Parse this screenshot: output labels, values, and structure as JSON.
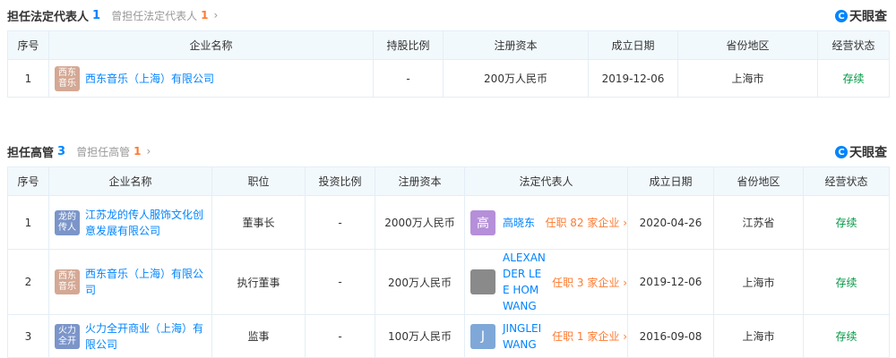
{
  "brand": {
    "name": "天眼查",
    "mark": "C"
  },
  "section1": {
    "title": "担任法定代表人",
    "count": "1",
    "sub_label": "曾担任法定代表人",
    "sub_count": "1",
    "headers": [
      "序号",
      "企业名称",
      "持股比例",
      "注册资本",
      "成立日期",
      "省份地区",
      "经营状态"
    ],
    "rows": [
      {
        "idx": "1",
        "logo_text": "西东\n音乐",
        "logo_color": "#d4a894",
        "company": "西东音乐（上海）有限公司",
        "share": "-",
        "capital": "200万人民币",
        "date": "2019-12-06",
        "region": "上海市",
        "status": "存续"
      }
    ]
  },
  "section2": {
    "title": "担任高管",
    "count": "3",
    "sub_label": "曾担任高管",
    "sub_count": "1",
    "headers": [
      "序号",
      "企业名称",
      "职位",
      "投资比例",
      "注册资本",
      "法定代表人",
      "成立日期",
      "省份地区",
      "经营状态"
    ],
    "rows": [
      {
        "idx": "1",
        "logo_text": "龙的\n传人",
        "logo_color": "#7b95c9",
        "company": "江苏龙的传人服饰文化创意发展有限公司",
        "position": "董事长",
        "invest": "-",
        "capital": "2000万人民币",
        "rep_avatar": "高",
        "rep_avatar_color": "#b58fd9",
        "rep": "高晓东",
        "rep_jobs": "任职 82 家企业",
        "date": "2020-04-26",
        "region": "江苏省",
        "status": "存续"
      },
      {
        "idx": "2",
        "logo_text": "西东\n音乐",
        "logo_color": "#d4a894",
        "company": "西东音乐（上海）有限公司",
        "position": "执行董事",
        "invest": "-",
        "capital": "200万人民币",
        "rep_avatar": "",
        "rep_avatar_color": "#8a8a8a",
        "rep": "ALEXANDER LEE HOMWANG",
        "rep_jobs": "任职 3 家企业",
        "date": "2019-12-06",
        "region": "上海市",
        "status": "存续"
      },
      {
        "idx": "3",
        "logo_text": "火力\n全开",
        "logo_color": "#7b95c9",
        "company": "火力全开商业（上海）有限公司",
        "position": "监事",
        "invest": "-",
        "capital": "100万人民币",
        "rep_avatar": "J",
        "rep_avatar_color": "#7fa8d8",
        "rep": "JINGLEI WANG",
        "rep_jobs": "任职 1 家企业",
        "date": "2016-09-08",
        "region": "上海市",
        "status": "存续"
      }
    ]
  }
}
